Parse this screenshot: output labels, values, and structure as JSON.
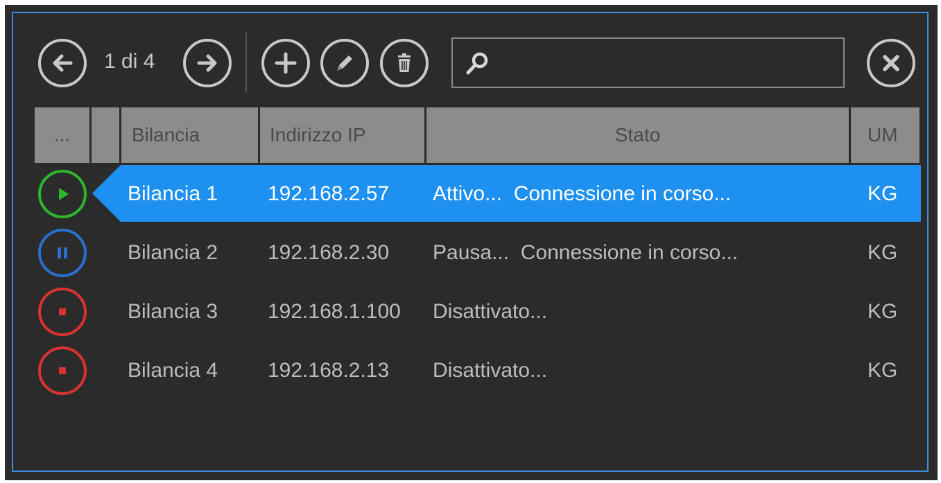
{
  "toolbar": {
    "prev_icon": "arrow-left-icon",
    "page_label": "1 di 4",
    "next_icon": "arrow-right-icon",
    "add_icon": "plus-icon",
    "edit_icon": "pencil-icon",
    "delete_icon": "trash-icon",
    "search_icon": "search-icon",
    "search_value": "",
    "close_icon": "close-icon"
  },
  "table": {
    "headers": {
      "status": "...",
      "blank": "",
      "bilancia": "Bilancia",
      "ip": "Indirizzo IP",
      "stato": "Stato",
      "um": "UM"
    },
    "rows": [
      {
        "status_icon": "play-icon",
        "bilancia": "Bilancia 1",
        "ip": "192.168.2.57",
        "stato": "Attivo...  Connessione in corso...",
        "um": "KG"
      },
      {
        "status_icon": "pause-icon",
        "bilancia": "Bilancia 2",
        "ip": "192.168.2.30",
        "stato": "Pausa...  Connessione in corso...",
        "um": "KG"
      },
      {
        "status_icon": "stop-icon",
        "bilancia": "Bilancia 3",
        "ip": "192.168.1.100",
        "stato": "Disattivato...",
        "um": "KG"
      },
      {
        "status_icon": "stop-icon",
        "bilancia": "Bilancia 4",
        "ip": "192.168.2.13",
        "stato": "Disattivato...",
        "um": "KG"
      }
    ]
  },
  "colors": {
    "background": "#2b2b2b",
    "frame": "#3a8ee0",
    "selection": "#1e90f0",
    "header": "#8c8c8c",
    "active": "#2db52d",
    "paused": "#2a6fd0",
    "stopped": "#d83232"
  }
}
